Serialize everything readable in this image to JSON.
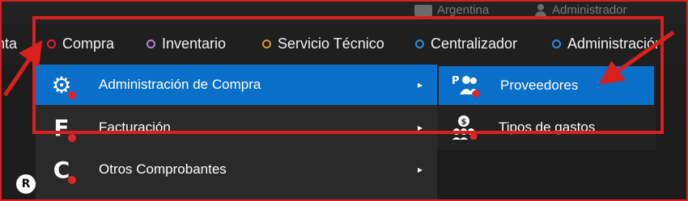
{
  "header": {
    "country": "Argentina",
    "user": "Administrador"
  },
  "navbar": {
    "items": [
      {
        "label": "nta",
        "dot_color": "#888888"
      },
      {
        "label": "Compra",
        "dot_color": "#e0242a"
      },
      {
        "label": "Inventario",
        "dot_color": "#b783d6"
      },
      {
        "label": "Servicio Técnico",
        "dot_color": "#e0952a"
      },
      {
        "label": "Centralizador",
        "dot_color": "#2a8fe0"
      },
      {
        "label": "Administración",
        "dot_color": "#2a8fe0"
      }
    ]
  },
  "menu": {
    "items": [
      {
        "label": "Administración de Compra",
        "icon": "gear-icon",
        "glyph": "⚙"
      },
      {
        "label": "Facturación",
        "icon": "invoice-f-icon",
        "glyph": "F"
      },
      {
        "label": "Otros Comprobantes",
        "icon": "vouchers-c-icon",
        "glyph": "C"
      }
    ],
    "chevron": "▸"
  },
  "submenu": {
    "items": [
      {
        "label": "Proveedores",
        "icon": "suppliers-icon"
      },
      {
        "label": "Tipos de gastos",
        "icon": "expense-types-icon"
      }
    ]
  },
  "logo": {
    "glyph": "R"
  },
  "colors": {
    "accent": "#0a6fc9",
    "annotation": "#d8201f",
    "badge": "#e0242a"
  }
}
